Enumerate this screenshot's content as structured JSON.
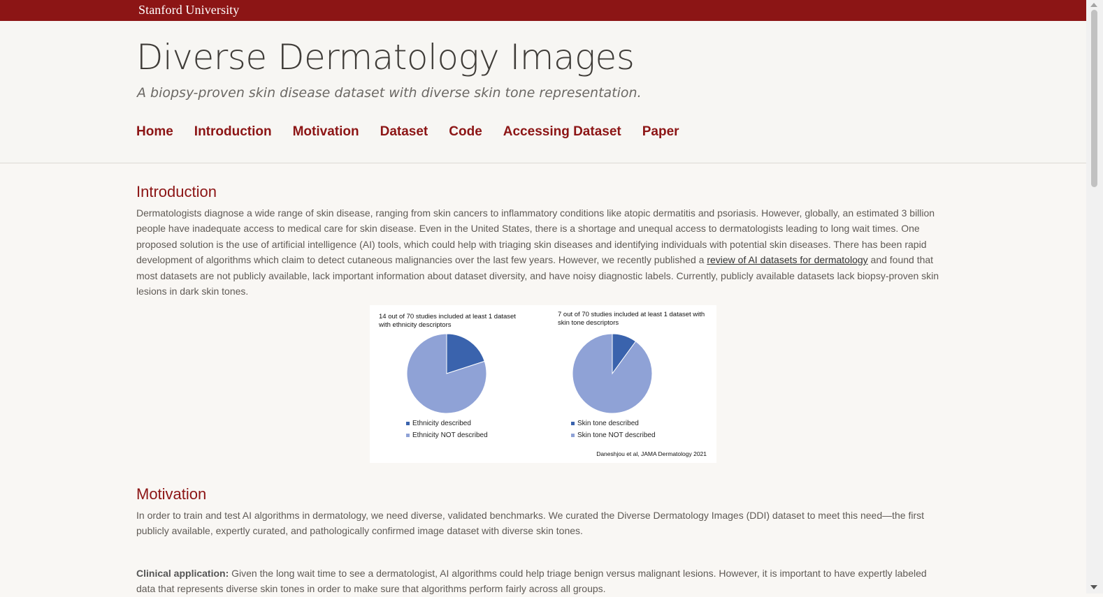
{
  "topbar": {
    "brand": "Stanford University"
  },
  "header": {
    "title": "Diverse Dermatology Images",
    "subtitle": "A biopsy-proven skin disease dataset with diverse skin tone representation."
  },
  "nav": {
    "items": [
      {
        "label": "Home"
      },
      {
        "label": "Introduction"
      },
      {
        "label": "Motivation"
      },
      {
        "label": "Dataset"
      },
      {
        "label": "Code"
      },
      {
        "label": "Accessing Dataset"
      },
      {
        "label": "Paper"
      }
    ]
  },
  "introduction": {
    "heading": "Introduction",
    "text_before_link": "Dermatologists diagnose a wide range of skin disease, ranging from skin cancers to inflammatory conditions like atopic dermatitis and psoriasis. However, globally, an estimated 3 billion people have inadequate access to medical care for skin disease. Even in the United States, there is a shortage and unequal access to dermatologists leading to long wait times. One proposed solution is the use of artificial intelligence (AI) tools, which could help with triaging skin diseases and identifying individuals with potential skin diseases. There has been rapid development of algorithms which claim to detect cutaneous malignancies over the last few years. However, we recently published a ",
    "link_text": "review of AI datasets for dermatology",
    "text_after_link": " and found that most datasets are not publicly available, lack important information about dataset diversity, and have noisy diagnostic labels. Currently, publicly available datasets lack biopsy-proven skin lesions in dark skin tones."
  },
  "figure": {
    "citation": "Daneshjou et al, JAMA Dermatology 2021",
    "colors": {
      "described": "#3a63ad",
      "not_described": "#8fa2d6"
    }
  },
  "chart_data": [
    {
      "type": "pie",
      "title": "14 out of 70 studies included at least 1 dataset with ethnicity descriptors",
      "labels": [
        "Ethnicity described",
        "Ethnicity NOT described"
      ],
      "values": [
        14,
        56
      ]
    },
    {
      "type": "pie",
      "title": "7 out of 70 studies included at least 1 dataset with skin tone descriptors",
      "labels": [
        "Skin tone described",
        "Skin tone NOT described"
      ],
      "values": [
        7,
        63
      ]
    }
  ],
  "motivation": {
    "heading": "Motivation",
    "text": "In order to train and test AI algorithms in dermatology, we need diverse, validated benchmarks. We curated the Diverse Dermatology Images (DDI) dataset to meet this need—the first publicly available, expertly curated, and pathologically confirmed image dataset with diverse skin tones.",
    "clinical_label": "Clinical application:",
    "clinical_text": " Given the long wait time to see a dermatologist, AI algorithms could help triage benign versus malignant lesions. However, it is important to have expertly labeled data that represents diverse skin tones in order to make sure that algorithms perform fairly across all groups."
  }
}
